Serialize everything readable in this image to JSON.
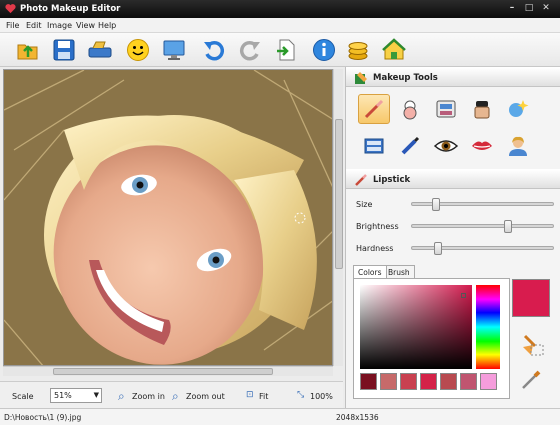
{
  "window": {
    "title": "Photo Makeup Editor",
    "controls": [
      "minimize",
      "maximize",
      "close"
    ]
  },
  "menu": [
    "File",
    "Edit",
    "Image",
    "View",
    "Help"
  ],
  "toolbar": [
    "open-icon",
    "save-icon",
    "scanner-icon",
    "smiley-icon",
    "monitor-icon",
    "undo-icon",
    "redo-icon",
    "export-icon",
    "info-icon",
    "coins-icon",
    "home-icon"
  ],
  "panel": {
    "makeup_tools_title": "Makeup Tools",
    "tools": [
      "lipstick-brush-icon",
      "blush-compact-icon",
      "eyeshadow-palette-icon",
      "foundation-jar-icon",
      "sparkle-icon",
      "eyeshadow-kit-icon",
      "eyeliner-pencil-icon",
      "eye-icon",
      "lips-icon",
      "person-icon"
    ],
    "section_title": "Lipstick",
    "sliders": [
      {
        "label": "Size",
        "value": 0.15
      },
      {
        "label": "Brightness",
        "value": 0.7
      },
      {
        "label": "Hardness",
        "value": 0.17
      }
    ],
    "tabs": [
      "Colors",
      "Brush"
    ],
    "swatches": [
      "#7a1020",
      "#c76a6a",
      "#c94050",
      "#d42248",
      "#b84a50",
      "#c05570",
      "#f59ddc"
    ],
    "accent_color": "#d81c4e"
  },
  "bottom": {
    "scale_label": "Scale",
    "scale_value": "51%",
    "zoom_in": "Zoom in",
    "zoom_out": "Zoom out",
    "fit": "Fit",
    "actual": "100%"
  },
  "status": {
    "path": "D:\\Новость\\1 (9).jpg",
    "dimensions": "2048x1536"
  }
}
